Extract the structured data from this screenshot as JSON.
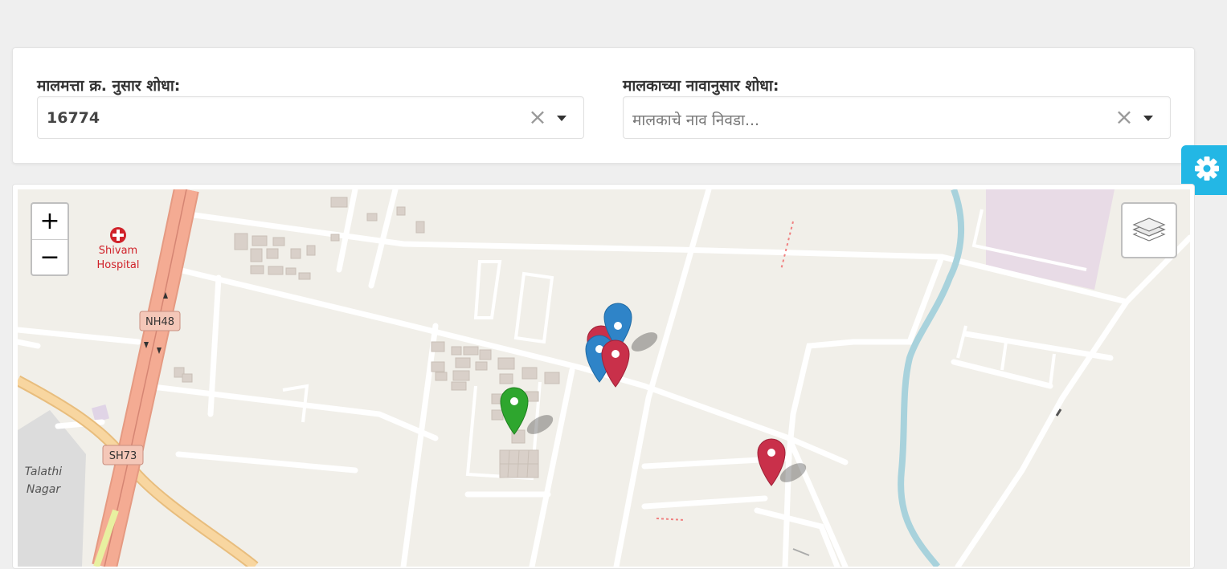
{
  "search": {
    "property_label": "मालमत्ता क्र. नुसार शोधा:",
    "property_value": "16774",
    "owner_label": "मालकाच्या नावानुसार शोधा:",
    "owner_placeholder": "मालकाचे नाव निवडा...",
    "clear_symbol": "×"
  },
  "settings": {
    "icon": "gear-icon",
    "color": "#23b7e5"
  },
  "map": {
    "zoom_in": "+",
    "zoom_out": "−",
    "layers_icon": "layers-icon",
    "labels": {
      "hospital": "Shivam",
      "hospital2": "Hospital",
      "nh": "NH48",
      "sh": "SH73",
      "talathi": "Talathi",
      "nagar": "Nagar"
    },
    "marker_colors": {
      "red": "#c9304a",
      "blue": "#2f84c8",
      "green": "#2ea62e"
    }
  }
}
